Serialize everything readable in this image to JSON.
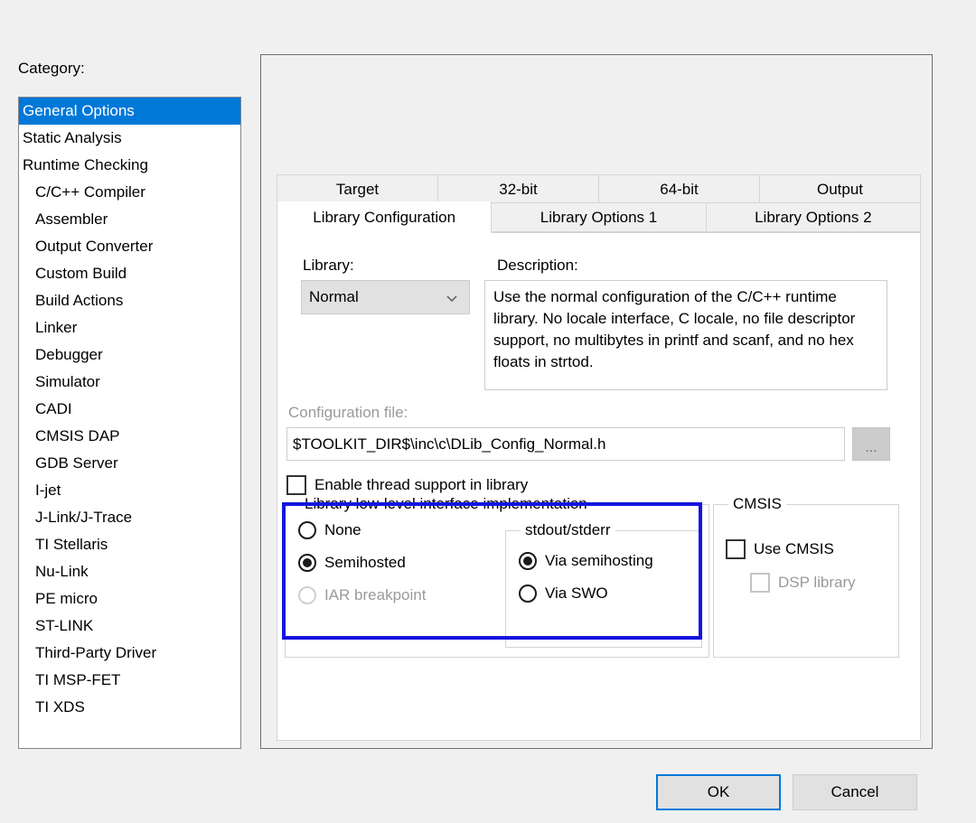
{
  "sidebar": {
    "label": "Category:",
    "items": [
      {
        "label": "General Options",
        "indent": false,
        "selected": true
      },
      {
        "label": "Static Analysis",
        "indent": false,
        "selected": false
      },
      {
        "label": "Runtime Checking",
        "indent": false,
        "selected": false
      },
      {
        "label": "C/C++ Compiler",
        "indent": true,
        "selected": false
      },
      {
        "label": "Assembler",
        "indent": true,
        "selected": false
      },
      {
        "label": "Output Converter",
        "indent": true,
        "selected": false
      },
      {
        "label": "Custom Build",
        "indent": true,
        "selected": false
      },
      {
        "label": "Build Actions",
        "indent": true,
        "selected": false
      },
      {
        "label": "Linker",
        "indent": true,
        "selected": false
      },
      {
        "label": "Debugger",
        "indent": true,
        "selected": false
      },
      {
        "label": "Simulator",
        "indent": true,
        "selected": false
      },
      {
        "label": "CADI",
        "indent": true,
        "selected": false
      },
      {
        "label": "CMSIS DAP",
        "indent": true,
        "selected": false
      },
      {
        "label": "GDB Server",
        "indent": true,
        "selected": false
      },
      {
        "label": "I-jet",
        "indent": true,
        "selected": false
      },
      {
        "label": "J-Link/J-Trace",
        "indent": true,
        "selected": false
      },
      {
        "label": "TI Stellaris",
        "indent": true,
        "selected": false
      },
      {
        "label": "Nu-Link",
        "indent": true,
        "selected": false
      },
      {
        "label": "PE micro",
        "indent": true,
        "selected": false
      },
      {
        "label": "ST-LINK",
        "indent": true,
        "selected": false
      },
      {
        "label": "Third-Party Driver",
        "indent": true,
        "selected": false
      },
      {
        "label": "TI MSP-FET",
        "indent": true,
        "selected": false
      },
      {
        "label": "TI XDS",
        "indent": true,
        "selected": false
      }
    ]
  },
  "tabs": {
    "row1": [
      {
        "label": "Target",
        "selected": false
      },
      {
        "label": "32-bit",
        "selected": false
      },
      {
        "label": "64-bit",
        "selected": false
      },
      {
        "label": "Output",
        "selected": false
      }
    ],
    "row2": [
      {
        "label": "Library Configuration",
        "selected": true
      },
      {
        "label": "Library Options 1",
        "selected": false
      },
      {
        "label": "Library Options 2",
        "selected": false
      }
    ]
  },
  "library": {
    "label": "Library:",
    "selected_option": "Normal",
    "options": [
      "Normal"
    ],
    "chevron_icon": "chevron-down-icon"
  },
  "description": {
    "label": "Description:",
    "text": "Use the normal configuration of the C/C++ runtime library. No locale interface, C locale, no file descriptor support, no multibytes in printf and scanf, and no hex floats in strtod."
  },
  "configuration_file": {
    "label": "Configuration file:",
    "value": "$TOOLKIT_DIR$\\inc\\c\\DLib_Config_Normal.h",
    "browse_label": "...",
    "disabled": true
  },
  "thread_support": {
    "label": "Enable thread support in library",
    "checked": false
  },
  "low_level_interface": {
    "title": "Library low-level interface implementation",
    "options": [
      {
        "label": "None",
        "checked": false,
        "disabled": false
      },
      {
        "label": "Semihosted",
        "checked": true,
        "disabled": false
      },
      {
        "label": "IAR breakpoint",
        "checked": false,
        "disabled": true
      }
    ],
    "stdout_group": {
      "title": "stdout/stderr",
      "options": [
        {
          "label": "Via semihosting",
          "checked": true,
          "disabled": false
        },
        {
          "label": "Via SWO",
          "checked": false,
          "disabled": false
        }
      ]
    }
  },
  "cmsis": {
    "title": "CMSIS",
    "options": [
      {
        "label": "Use CMSIS",
        "checked": false,
        "disabled": false
      },
      {
        "label": "DSP library",
        "checked": false,
        "disabled": true
      }
    ]
  },
  "footer": {
    "ok_label": "OK",
    "cancel_label": "Cancel"
  },
  "highlight": {
    "color": "#1414E0",
    "target": "low-level-interface-group"
  },
  "theme": {
    "background": "#F0F0F0",
    "accent": "#0078D7",
    "selection": "#0078D7",
    "disabled_text": "#9A9A9A",
    "panel_white": "#FFFFFF"
  }
}
